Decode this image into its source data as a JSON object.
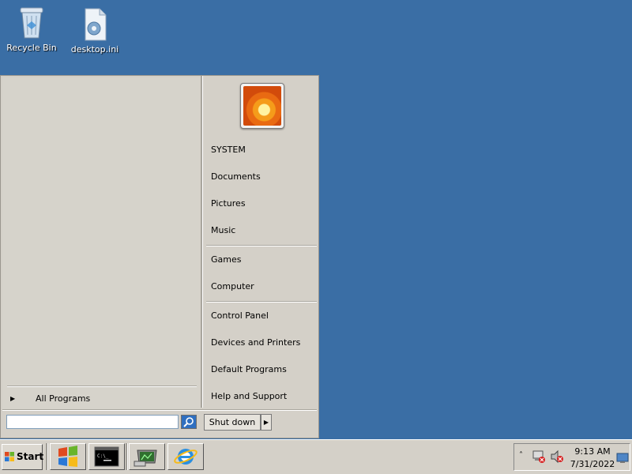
{
  "desktop": {
    "icons": [
      {
        "label": "Recycle Bin",
        "icon": "recycle-bin-icon"
      },
      {
        "label": "desktop.ini",
        "icon": "settings-file-icon"
      }
    ]
  },
  "start_menu": {
    "user_picture": "flower-user-picture",
    "right_items": {
      "system": "SYSTEM",
      "documents": "Documents",
      "pictures": "Pictures",
      "music": "Music",
      "games": "Games",
      "computer": "Computer",
      "control_panel": "Control Panel",
      "devices_printers": "Devices and Printers",
      "default_programs": "Default Programs",
      "help_support": "Help and Support"
    },
    "all_programs": "All Programs",
    "search": {
      "value": "",
      "placeholder": ""
    },
    "shutdown_label": "Shut down"
  },
  "taskbar": {
    "start_label": "Start",
    "pinned": [
      "windows-explorer-icon",
      "command-prompt-icon",
      "server-manager-icon",
      "internet-explorer-icon"
    ],
    "clock": {
      "time": "9:13 AM",
      "date": "7/31/2022"
    }
  },
  "colors": {
    "desktop": "#3a6ea5",
    "chrome": "#d4d0c8"
  }
}
